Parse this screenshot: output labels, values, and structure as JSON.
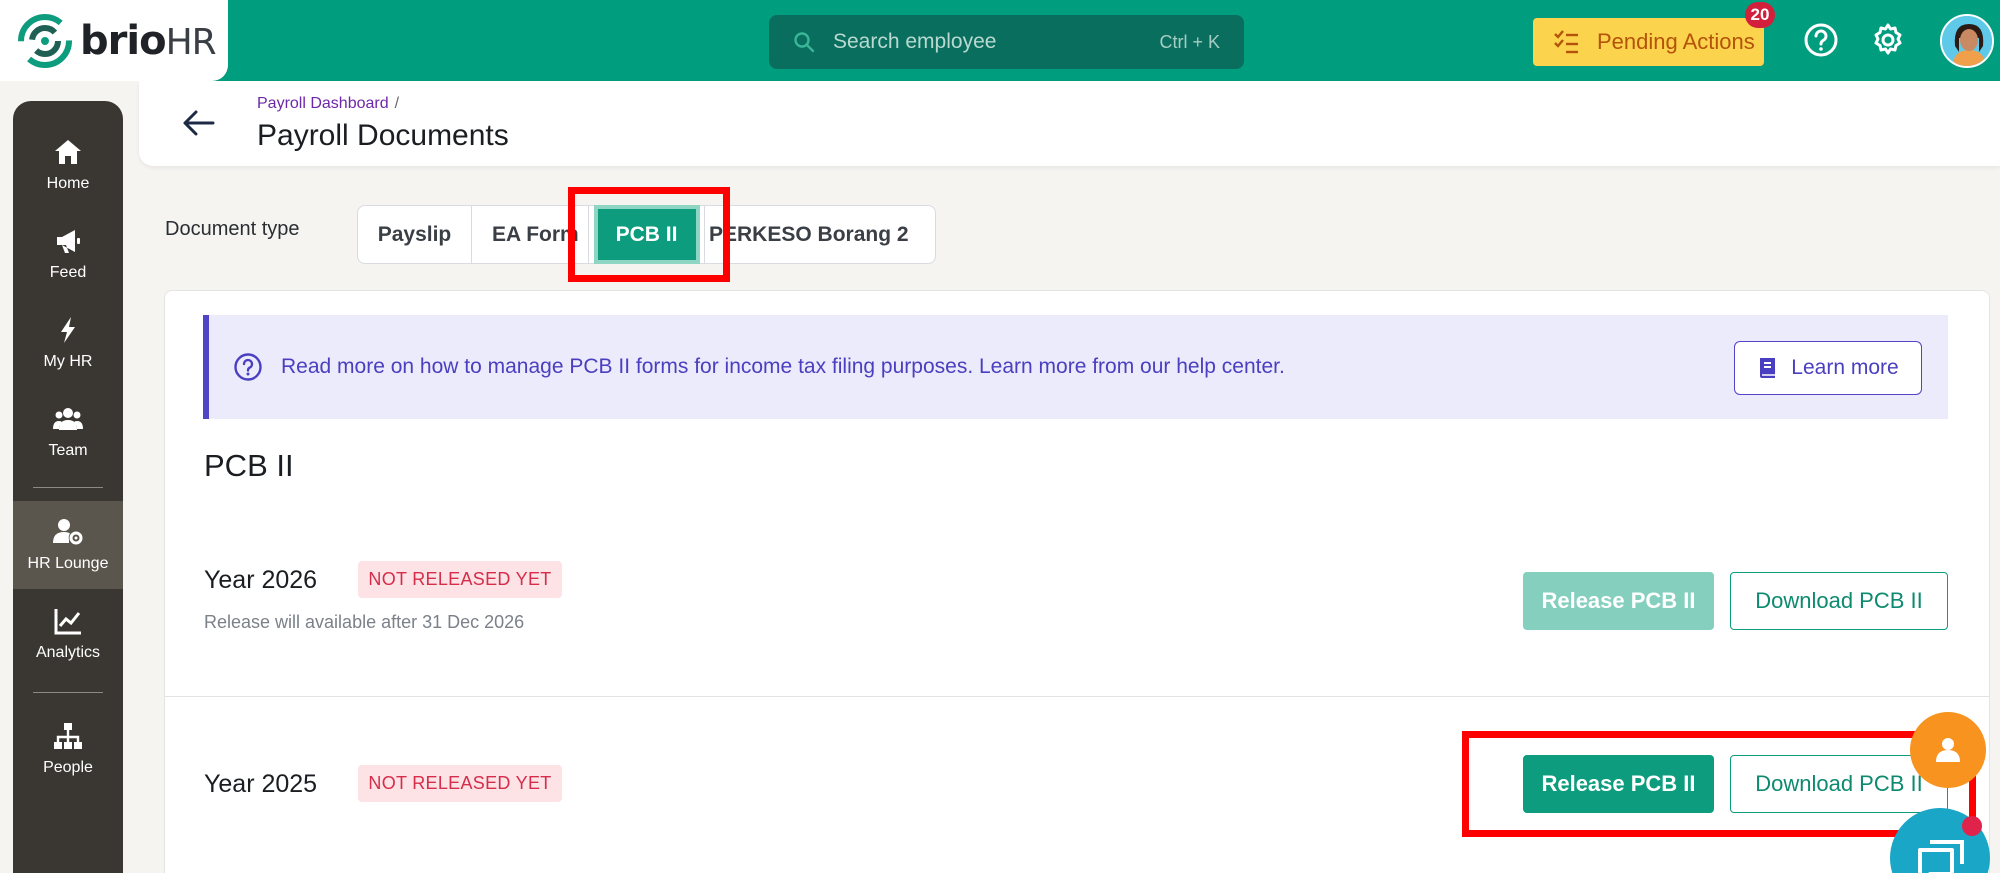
{
  "topbar": {
    "logo_text": "brio",
    "logo_text_hr": "HR",
    "search_placeholder": "Search employee",
    "search_shortcut": "Ctrl + K",
    "pending_label": "Pending Actions",
    "pending_count": "20",
    "help_icon": "question-circle-icon",
    "settings_icon": "gear-icon",
    "brand_color": "#009d7e"
  },
  "sidebar": {
    "items": [
      {
        "label": "Home",
        "icon": "home-icon"
      },
      {
        "label": "Feed",
        "icon": "megaphone-icon"
      },
      {
        "label": "My HR",
        "icon": "bolt-icon"
      },
      {
        "label": "Team",
        "icon": "users-icon"
      },
      {
        "label": "HR Lounge",
        "icon": "user-cog-icon",
        "active": true
      },
      {
        "label": "Analytics",
        "icon": "chart-line-icon"
      },
      {
        "label": "People",
        "icon": "org-chart-icon"
      }
    ]
  },
  "header": {
    "breadcrumb": "Payroll Dashboard",
    "breadcrumb_sep": "/",
    "title": "Payroll Documents"
  },
  "document_type": {
    "label": "Document type",
    "tabs": [
      "Payslip",
      "EA Form",
      "PCB II",
      "PERKESO Borang 2"
    ],
    "selected": "PCB II"
  },
  "info_banner": {
    "text": "Read more on how to manage PCB II forms for income tax filing purposes. Learn more from our help center.",
    "button_label": "Learn more"
  },
  "section": {
    "title": "PCB II",
    "rows": [
      {
        "year": "Year 2026",
        "status": "NOT RELEASED YET",
        "note": "Release will available after 31 Dec 2026",
        "release_label": "Release PCB II",
        "release_disabled": true,
        "download_label": "Download PCB II"
      },
      {
        "year": "Year 2025",
        "status": "NOT RELEASED YET",
        "release_label": "Release PCB II",
        "release_disabled": false,
        "download_label": "Download PCB II"
      }
    ]
  }
}
